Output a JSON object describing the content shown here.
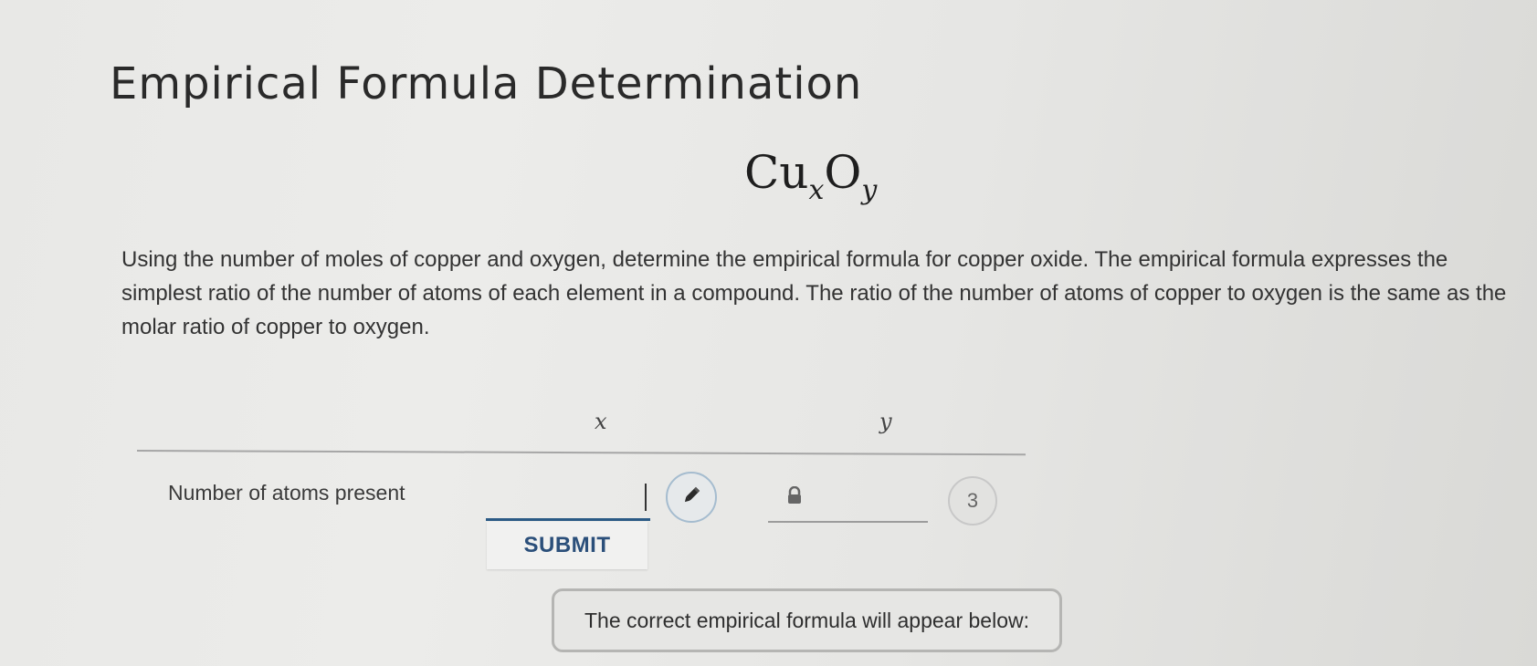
{
  "header": {
    "title": "Empirical Formula Determination"
  },
  "formula": {
    "element1": "Cu",
    "sub1": "x",
    "element2": "O",
    "sub2": "y"
  },
  "instructions": "Using the number of moles of copper and oxygen, determine the empirical formula for copper oxide. The empirical formula expresses the simplest ratio of the number of atoms of each element in a compound. The ratio of the number of atoms of copper to oxygen is the same as the molar ratio of copper to oxygen.",
  "table": {
    "columns": [
      "x",
      "y"
    ],
    "row_label": "Number of atoms present",
    "x_input": {
      "value": "",
      "placeholder": ""
    },
    "y_locked_value": "",
    "attempts_remaining": "3"
  },
  "submit_label": "SUBMIT",
  "result_text": "The correct empirical formula will appear below:",
  "icons": {
    "edit": "pencil-icon",
    "lock": "lock-icon"
  },
  "colors": {
    "accent": "#2b5a85",
    "submit_text": "#2b4f7a"
  }
}
